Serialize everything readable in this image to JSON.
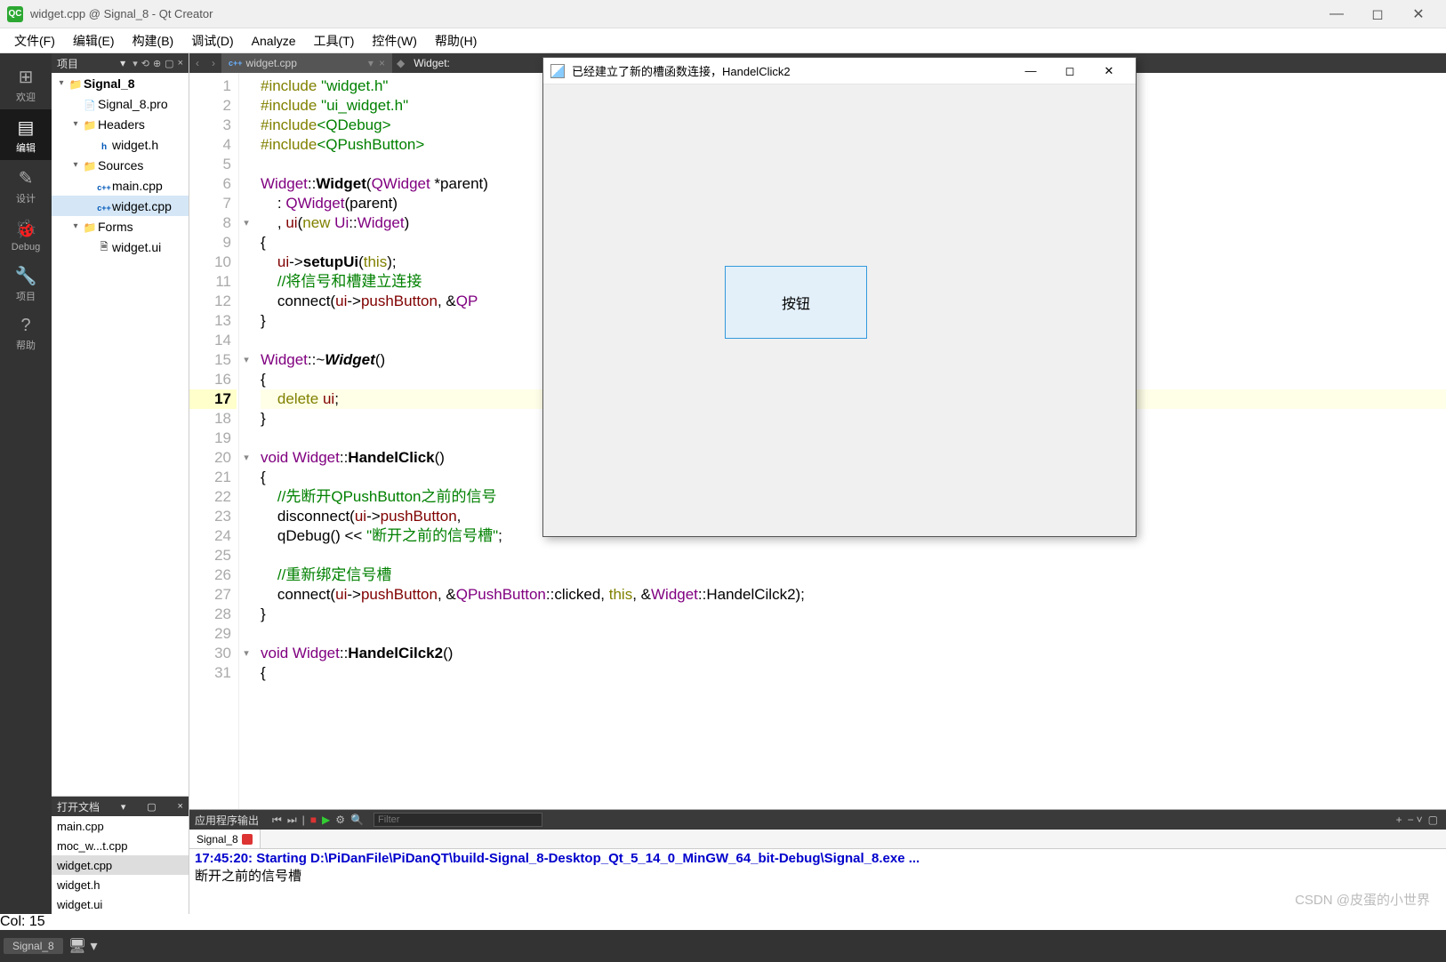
{
  "window": {
    "title": "widget.cpp @ Signal_8 - Qt Creator",
    "app_icon_text": "QC"
  },
  "menubar": [
    "文件(F)",
    "编辑(E)",
    "构建(B)",
    "调试(D)",
    "Analyze",
    "工具(T)",
    "控件(W)",
    "帮助(H)"
  ],
  "rail": [
    {
      "icon": "⊞",
      "label": "欢迎"
    },
    {
      "icon": "▤",
      "label": "编辑"
    },
    {
      "icon": "✎",
      "label": "设计"
    },
    {
      "icon": "🐞",
      "label": "Debug"
    },
    {
      "icon": "🔧",
      "label": "项目"
    },
    {
      "icon": "?",
      "label": "帮助"
    }
  ],
  "rail_active": 1,
  "sidebar": {
    "title": "项目",
    "tree": [
      {
        "depth": 0,
        "tw": "▾",
        "ico": "folder-ico",
        "label": "Signal_8",
        "bold": true
      },
      {
        "depth": 1,
        "tw": "",
        "ico": "file-pro",
        "label": "Signal_8.pro"
      },
      {
        "depth": 1,
        "tw": "▾",
        "ico": "folder-ico",
        "label": "Headers"
      },
      {
        "depth": 2,
        "tw": "",
        "ico": "file-h",
        "label": "widget.h"
      },
      {
        "depth": 1,
        "tw": "▾",
        "ico": "folder-ico",
        "label": "Sources"
      },
      {
        "depth": 2,
        "tw": "",
        "ico": "file-cpp",
        "label": "main.cpp"
      },
      {
        "depth": 2,
        "tw": "",
        "ico": "file-cpp",
        "label": "widget.cpp",
        "sel": true
      },
      {
        "depth": 1,
        "tw": "▾",
        "ico": "folder-ico",
        "label": "Forms"
      },
      {
        "depth": 2,
        "tw": "",
        "ico": "file-ui",
        "label": "widget.ui"
      }
    ]
  },
  "open_docs": {
    "title": "打开文档",
    "items": [
      "main.cpp",
      "moc_w...t.cpp",
      "widget.cpp",
      "widget.h",
      "widget.ui"
    ],
    "selected": 2
  },
  "editor": {
    "tabs": [
      {
        "label": "widget.cpp",
        "active": true
      }
    ],
    "breadcrumb_prefix": "Widget:",
    "cursor_info": "Col: 15",
    "current_line": 17,
    "fold_lines": [
      8,
      15,
      20,
      30
    ],
    "lines": [
      {
        "n": 1,
        "html": "<span class='kw'>#include</span> <span class='str'>\"widget.h\"</span>"
      },
      {
        "n": 2,
        "html": "<span class='kw'>#include</span> <span class='str'>\"ui_widget.h\"</span>"
      },
      {
        "n": 3,
        "html": "<span class='kw'>#include</span><span class='str'>&lt;QDebug&gt;</span>"
      },
      {
        "n": 4,
        "html": "<span class='kw'>#include</span><span class='str'>&lt;QPushButton&gt;</span>"
      },
      {
        "n": 5,
        "html": ""
      },
      {
        "n": 6,
        "html": "<span class='typ'>Widget</span>::<span class='fn'>Widget</span>(<span class='typ'>QWidget</span> *parent)"
      },
      {
        "n": 7,
        "html": "    : <span class='typ'>QWidget</span>(parent)"
      },
      {
        "n": 8,
        "html": "    , <span class='mem'>ui</span>(<span class='kw'>new</span> <span class='typ'>Ui</span>::<span class='typ'>Widget</span>)"
      },
      {
        "n": 9,
        "html": "{"
      },
      {
        "n": 10,
        "html": "    <span class='mem'>ui</span>-&gt;<span class='fn'>setupUi</span>(<span class='kw'>this</span>);"
      },
      {
        "n": 11,
        "html": "    <span class='cmt'>//将信号和槽建立连接</span>"
      },
      {
        "n": 12,
        "html": "    connect(<span class='mem'>ui</span>-&gt;<span class='mem'>pushButton</span>, &amp;<span class='typ'>QP</span>"
      },
      {
        "n": 13,
        "html": "}"
      },
      {
        "n": 14,
        "html": ""
      },
      {
        "n": 15,
        "html": "<span class='typ'>Widget</span>::~<span class='fni'>Widget</span>()"
      },
      {
        "n": 16,
        "html": "{"
      },
      {
        "n": 17,
        "html": "    <span class='kw'>delete</span> <span class='mem'>ui</span>;"
      },
      {
        "n": 18,
        "html": "}"
      },
      {
        "n": 19,
        "html": ""
      },
      {
        "n": 20,
        "html": "<span class='typ'>void</span> <span class='typ'>Widget</span>::<span class='fn'>HandelClick</span>()"
      },
      {
        "n": 21,
        "html": "{"
      },
      {
        "n": 22,
        "html": "    <span class='cmt'>//先断开QPushButton之前的信号</span>"
      },
      {
        "n": 23,
        "html": "    disconnect(<span class='mem'>ui</span>-&gt;<span class='mem'>pushButton</span>,"
      },
      {
        "n": 24,
        "html": "    qDebug() &lt;&lt; <span class='str'>\"断开之前的信号槽\"</span>;"
      },
      {
        "n": 25,
        "html": ""
      },
      {
        "n": 26,
        "html": "    <span class='cmt'>//重新绑定信号槽</span>"
      },
      {
        "n": 27,
        "html": "    connect(<span class='mem'>ui</span>-&gt;<span class='mem'>pushButton</span>, &amp;<span class='typ'>QPushButton</span>::clicked, <span class='kw'>this</span>, &amp;<span class='typ'>Widget</span>::HandelCilck2);"
      },
      {
        "n": 28,
        "html": "}"
      },
      {
        "n": 29,
        "html": ""
      },
      {
        "n": 30,
        "html": "<span class='typ'>void</span> <span class='typ'>Widget</span>::<span class='fn'>HandelCilck2</span>()"
      },
      {
        "n": 31,
        "html": "{"
      }
    ]
  },
  "output": {
    "title": "应用程序输出",
    "filter_placeholder": "Filter",
    "tab_label": "Signal_8",
    "start_line": "17:45:20: Starting D:\\PiDanFile\\PiDanQT\\build-Signal_8-Desktop_Qt_5_14_0_MinGW_64_bit-Debug\\Signal_8.exe ...",
    "log_line": "断开之前的信号槽"
  },
  "overlay": {
    "title": "已经建立了新的槽函数连接，HandelClick2",
    "button_label": "按钮"
  },
  "statusbar": {
    "project": "Signal_8"
  },
  "watermark": "CSDN @皮蛋的小世界"
}
